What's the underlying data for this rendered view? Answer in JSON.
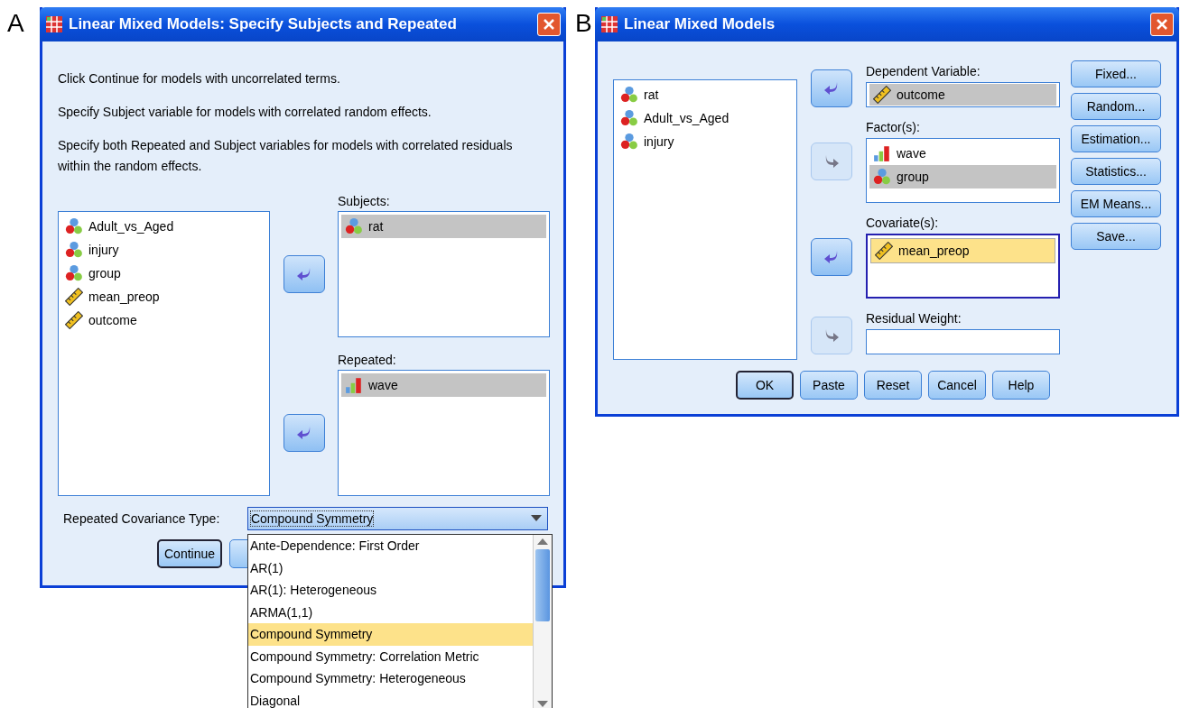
{
  "panel_a": {
    "label": "A",
    "title": "Linear Mixed Models: Specify Subjects and Repeated",
    "instructions": [
      "Click Continue for models with uncorrelated terms.",
      "Specify Subject variable for models with correlated random effects.",
      "Specify both Repeated and Subject variables for models with correlated residuals within the random effects."
    ],
    "variables": [
      {
        "name": "Adult_vs_Aged",
        "kind": "nominal"
      },
      {
        "name": "injury",
        "kind": "nominal"
      },
      {
        "name": "group",
        "kind": "nominal"
      },
      {
        "name": "mean_preop",
        "kind": "scale"
      },
      {
        "name": "outcome",
        "kind": "scale"
      }
    ],
    "targets": [
      {
        "label": "Subjects:",
        "move_button": {
          "kind": "left",
          "enabled": true
        },
        "items": [
          {
            "name": "rat",
            "kind": "nominal",
            "selected": true
          }
        ]
      },
      {
        "label": "Repeated:",
        "move_button": {
          "kind": "left",
          "enabled": true
        },
        "items": [
          {
            "name": "wave",
            "kind": "ordinal",
            "selected": true
          }
        ]
      }
    ],
    "covariance_type": {
      "label": "Repeated Covariance Type:",
      "value": "Compound Symmetry",
      "expanded": true,
      "options": [
        {
          "label": "Ante-Dependence: First Order",
          "selected": false
        },
        {
          "label": "AR(1)",
          "selected": false
        },
        {
          "label": "AR(1): Heterogeneous",
          "selected": false
        },
        {
          "label": "ARMA(1,1)",
          "selected": false
        },
        {
          "label": "Compound Symmetry",
          "selected": true
        },
        {
          "label": "Compound Symmetry: Correlation Metric",
          "selected": false
        },
        {
          "label": "Compound Symmetry: Heterogeneous",
          "selected": false
        },
        {
          "label": "Diagonal",
          "selected": false
        }
      ]
    },
    "buttons": [
      {
        "label": "Continue",
        "default": true
      },
      {
        "default": false
      }
    ]
  },
  "panel_b": {
    "label": "B",
    "title": "Linear Mixed Models",
    "variables": [
      {
        "name": "rat",
        "kind": "nominal"
      },
      {
        "name": "Adult_vs_Aged",
        "kind": "nominal"
      },
      {
        "name": "injury",
        "kind": "nominal"
      }
    ],
    "targets": [
      {
        "label": "Dependent Variable:",
        "kind": "single",
        "move_button": {
          "kind": "left",
          "enabled": true
        },
        "focused": false,
        "items": [
          {
            "name": "outcome",
            "kind": "scale",
            "selected": true
          }
        ]
      },
      {
        "label": "Factor(s):",
        "kind": "multi",
        "move_button": {
          "kind": "right",
          "enabled": false
        },
        "focused": false,
        "items": [
          {
            "name": "wave",
            "kind": "ordinal",
            "selected": false
          },
          {
            "name": "group",
            "kind": "nominal",
            "selected": true
          }
        ]
      },
      {
        "label": "Covariate(s):",
        "kind": "multi",
        "move_button": {
          "kind": "left",
          "enabled": true
        },
        "focused": true,
        "items": [
          {
            "name": "mean_preop",
            "kind": "scale",
            "selected": true
          }
        ]
      },
      {
        "label": "Residual Weight:",
        "kind": "single",
        "move_button": {
          "kind": "right",
          "enabled": false
        },
        "focused": false
      }
    ],
    "side_buttons": [
      "Fixed...",
      "Random...",
      "Estimation...",
      "Statistics...",
      "EM Means...",
      "Save..."
    ],
    "buttons": [
      {
        "label": "OK",
        "default": true
      },
      {
        "label": "Paste",
        "default": false
      },
      {
        "label": "Reset",
        "default": false
      },
      {
        "label": "Cancel",
        "default": false
      },
      {
        "label": "Help",
        "default": false
      }
    ]
  }
}
